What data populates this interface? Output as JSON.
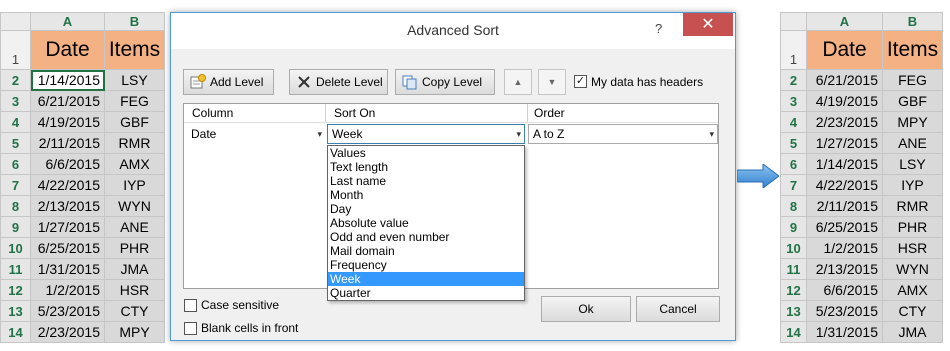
{
  "left_sheet": {
    "col_headers": [
      "A",
      "B"
    ],
    "header_row": {
      "row": "1",
      "date": "Date",
      "items": "Items"
    },
    "rows": [
      {
        "row": "2",
        "date": "1/14/2015",
        "item": "LSY"
      },
      {
        "row": "3",
        "date": "6/21/2015",
        "item": "FEG"
      },
      {
        "row": "4",
        "date": "4/19/2015",
        "item": "GBF"
      },
      {
        "row": "5",
        "date": "2/11/2015",
        "item": "RMR"
      },
      {
        "row": "6",
        "date": "6/6/2015",
        "item": "AMX"
      },
      {
        "row": "7",
        "date": "4/22/2015",
        "item": "IYP"
      },
      {
        "row": "8",
        "date": "2/13/2015",
        "item": "WYN"
      },
      {
        "row": "9",
        "date": "1/27/2015",
        "item": "ANE"
      },
      {
        "row": "10",
        "date": "6/25/2015",
        "item": "PHR"
      },
      {
        "row": "11",
        "date": "1/31/2015",
        "item": "JMA"
      },
      {
        "row": "12",
        "date": "1/2/2015",
        "item": "HSR"
      },
      {
        "row": "13",
        "date": "5/23/2015",
        "item": "CTY"
      },
      {
        "row": "14",
        "date": "2/23/2015",
        "item": "MPY"
      }
    ]
  },
  "right_sheet": {
    "col_headers": [
      "A",
      "B"
    ],
    "header_row": {
      "row": "1",
      "date": "Date",
      "items": "Items"
    },
    "rows": [
      {
        "row": "2",
        "date": "6/21/2015",
        "item": "FEG"
      },
      {
        "row": "3",
        "date": "4/19/2015",
        "item": "GBF"
      },
      {
        "row": "4",
        "date": "2/23/2015",
        "item": "MPY"
      },
      {
        "row": "5",
        "date": "1/27/2015",
        "item": "ANE"
      },
      {
        "row": "6",
        "date": "1/14/2015",
        "item": "LSY"
      },
      {
        "row": "7",
        "date": "4/22/2015",
        "item": "IYP"
      },
      {
        "row": "8",
        "date": "2/11/2015",
        "item": "RMR"
      },
      {
        "row": "9",
        "date": "6/25/2015",
        "item": "PHR"
      },
      {
        "row": "10",
        "date": "1/2/2015",
        "item": "HSR"
      },
      {
        "row": "11",
        "date": "2/13/2015",
        "item": "WYN"
      },
      {
        "row": "12",
        "date": "6/6/2015",
        "item": "AMX"
      },
      {
        "row": "13",
        "date": "5/23/2015",
        "item": "CTY"
      },
      {
        "row": "14",
        "date": "1/31/2015",
        "item": "JMA"
      }
    ]
  },
  "dialog": {
    "title": "Advanced Sort",
    "help": "?",
    "close": "✕",
    "toolbar": {
      "add_level": "Add Level",
      "delete_level": "Delete Level",
      "copy_level": "Copy Level",
      "move_up": "▲",
      "move_down": "▼",
      "headers_label": "My data has headers",
      "headers_checked": "✓"
    },
    "columns": {
      "column": "Column",
      "sort_on": "Sort On",
      "order": "Order"
    },
    "level": {
      "column": "Date",
      "sort_on": "Week",
      "order": "A to Z",
      "dd": "▾"
    },
    "sort_on_options": [
      "Values",
      "Text length",
      "Last name",
      "Month",
      "Day",
      "Absolute value",
      "Odd and even number",
      "Mail domain",
      "Frequency",
      "Week",
      "Quarter"
    ],
    "case_sensitive": "Case sensitive",
    "blank_cells": "Blank cells in front",
    "ok": "Ok",
    "cancel": "Cancel"
  },
  "colors": {
    "header_fill": "#f4b183",
    "cell_fill": "#d9d9d9",
    "excel_green": "#217346",
    "close_red": "#c75050",
    "selection_blue": "#3399ff",
    "arrow_blue": "#3a8fd8"
  }
}
